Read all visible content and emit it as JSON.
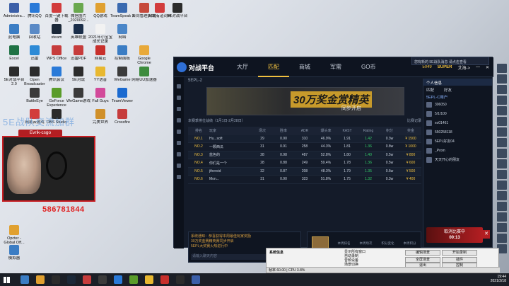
{
  "desktop_icons": [
    {
      "label": "Administra...",
      "color": "#3b5fa8"
    },
    {
      "label": "腾讯QQ",
      "color": "#2a7ad8"
    },
    {
      "label": "百度一键下载器",
      "color": "#d23c3c"
    },
    {
      "label": "微信图片_2020092...",
      "color": "#6aa84f"
    },
    {
      "label": "QQ游戏",
      "color": "#e0a030"
    },
    {
      "label": "TeamSpeak 3",
      "color": "#3a6ab0"
    },
    {
      "label": "合同管理(102)",
      "color": "#c64a3c"
    },
    {
      "label": "网易有道词典",
      "color": "#d23c3c"
    },
    {
      "label": "5E对战平台",
      "color": "#2c2c2c"
    },
    {
      "label": "此电脑",
      "color": "#3b7dc4"
    },
    {
      "label": "回收站",
      "color": "#5a8ac6"
    },
    {
      "label": "steam",
      "color": "#1b2838"
    },
    {
      "label": "英雄联盟",
      "color": "#1a2e4a"
    },
    {
      "label": "2021年小宝宝成长记录",
      "color": "#f2f2f2"
    },
    {
      "label": "网络",
      "color": "#4a86c8"
    },
    {
      "label": "Excel",
      "color": "#1f7244"
    },
    {
      "label": "迅雷",
      "color": "#2d8ad6"
    },
    {
      "label": "WPS Office",
      "color": "#c63c3c"
    },
    {
      "label": "迅雷PDF",
      "color": "#c63c3c"
    },
    {
      "label": "网易云",
      "color": "#c8302c"
    },
    {
      "label": "控制面板",
      "color": "#3b7dc4"
    },
    {
      "label": "Google Chrome",
      "color": "#e8a93a"
    },
    {
      "label": "5E对战平台2.0",
      "color": "#2c2c2c"
    },
    {
      "label": "Open Broadcaster",
      "color": "#2b2b2b"
    },
    {
      "label": "腾讯会议",
      "color": "#2a7ad8"
    },
    {
      "label": "5E对战",
      "color": "#2c2c2c"
    },
    {
      "label": "YY语音",
      "color": "#e8b830"
    },
    {
      "label": "WeGame",
      "color": "#3b3b3b"
    },
    {
      "label": "网易UU加速器",
      "color": "#3d8c3d"
    },
    {
      "label": "BattleEye",
      "color": "#3b3b3b"
    },
    {
      "label": "GeForce Experience",
      "color": "#5a9c2a"
    },
    {
      "label": "WeGame游戏",
      "color": "#3b3b3b"
    },
    {
      "label": "Fall Guys",
      "color": "#d24a9a"
    },
    {
      "label": "TeamViewer",
      "color": "#1b6ad0"
    },
    {
      "label": "网易云游戏",
      "color": "#d23c3c"
    },
    {
      "label": "OBS Studio",
      "color": "#2b2b2b"
    },
    {
      "label": "完美世界",
      "color": "#d0902a"
    },
    {
      "label": "Crossfire",
      "color": "#c63c3c"
    },
    {
      "label": "Opcter - Global Off...",
      "color": "#e0a030"
    },
    {
      "label": "模拟器",
      "color": "#3b7dc4"
    }
  ],
  "overlay": {
    "text": "5E战队交流加群"
  },
  "webcam": {
    "title": "Evrik-csgo",
    "number": "586781844"
  },
  "app": {
    "logo": "对战平台",
    "nav": [
      "大厅",
      "匹配",
      "商城",
      "军需",
      "GO币"
    ],
    "active_nav": 1,
    "coins": "5049",
    "rank_label": "SUPER",
    "user_name": "艾海->",
    "subtab": "5EPL-2",
    "banner_title": "30万奖金赏精英",
    "banner_sub": "同步开启",
    "rank_header_left": "本赛季排位战绩（1月1日-2月28日）",
    "rank_header_right": "比赛记录",
    "columns": [
      "排名",
      "玩家",
      "场次",
      "胜率",
      "ADR",
      "爆头率",
      "KAST",
      "Rating",
      "积分",
      "奖金"
    ],
    "rows": [
      [
        "NO.1",
        "Hu...soft",
        "29",
        "0.90",
        "310",
        "46.9%",
        "1.91",
        "1.42",
        "0.3w",
        "¥ 1500"
      ],
      [
        "NO.2",
        "一颗西瓜",
        "31",
        "0.91",
        "258",
        "44.3%",
        "1.81",
        "1.36",
        "0.8w",
        "¥ 1000"
      ],
      [
        "NO.3",
        "蓝色的",
        "28",
        "0.98",
        "487",
        "52.8%",
        "1.80",
        "1.40",
        "0.5w",
        "¥ 800"
      ],
      [
        "NO.4",
        "你们是一个",
        "28",
        "0.88",
        "249",
        "59.4%",
        "1.78",
        "1.36",
        "0.5w",
        "¥ 600"
      ],
      [
        "NO.5",
        "jtheroid",
        "32",
        "0.87",
        "208",
        "48.3%",
        "1.79",
        "1.35",
        "0.6w",
        "¥ 500"
      ],
      [
        "NO.6",
        "Mon...",
        "31",
        "0.90",
        "323",
        "51.8%",
        "1.75",
        "1.32",
        "0.3w",
        "¥ 400"
      ]
    ],
    "notice": [
      "系统通知：恭喜获得本周最佳玩家奖励",
      "30万奖金赛精英赛同步开启",
      "5EPL大奖赛火热进行中"
    ],
    "notice_placeholder": "请输入聊天内容",
    "send_label": "发送",
    "stats_player": "Zhuzi",
    "stats": [
      {
        "label": "本周排名",
        "value": "NO.145"
      },
      {
        "label": "本周场次",
        "value": "16"
      },
      {
        "label": "积分变化",
        "value": "-30.00"
      },
      {
        "label": "本周积分",
        "value": "1205"
      }
    ],
    "panel_tabs": [
      "匹配",
      "好友"
    ],
    "panel_head": "5EPL-C用户",
    "panel_section": "个人信息",
    "friends": [
      "306050",
      "5/1/100",
      "xo01461",
      "550258118",
      "5EPL好友04",
      "_Prom",
      "天天开心的朋友"
    ],
    "match_label": "取消比赛中",
    "match_time": "00:13",
    "popup": "您有新的 5E战队消息 请点击查看"
  },
  "tool": {
    "title": "系统信息",
    "buttons": [
      "编辑场景",
      "开始录制",
      "全屏场景",
      "插件",
      "退出",
      "控制"
    ],
    "status": "帧率 60.00 | CPU 3.8%",
    "options": [
      "显示所有窗口",
      "自动录制",
      "音频设备",
      "场景切换"
    ]
  },
  "taskbar": {
    "time": "19:44",
    "date": "2021/2/18"
  }
}
